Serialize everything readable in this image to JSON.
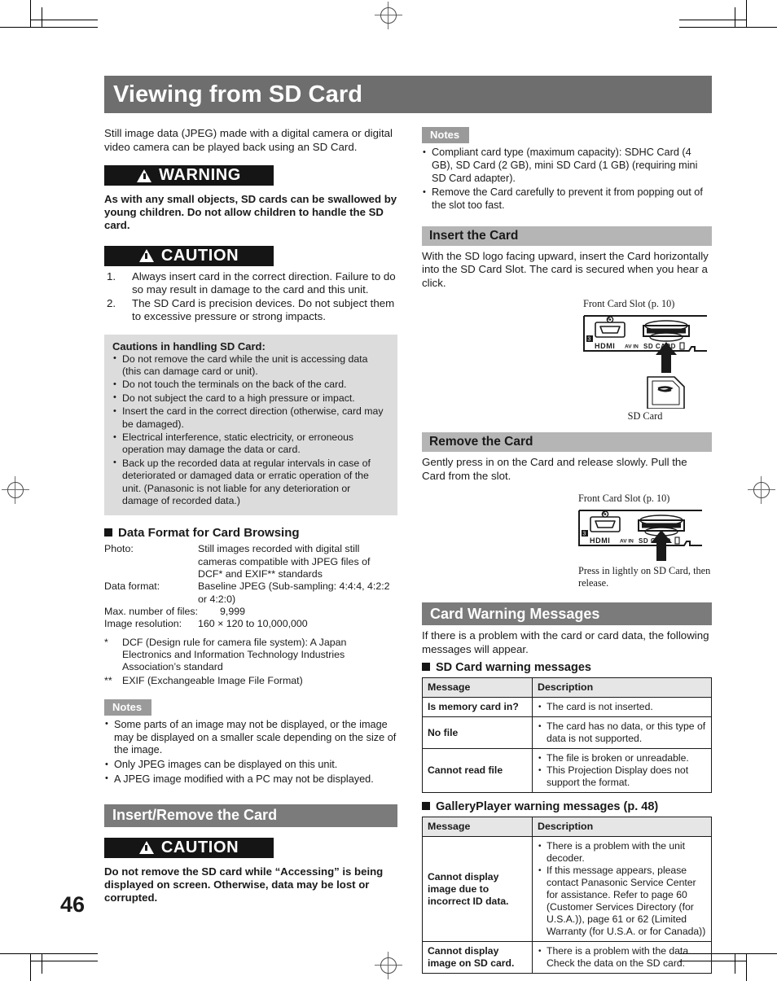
{
  "page": {
    "number": "46",
    "title": "Viewing from SD Card"
  },
  "left": {
    "intro": "Still image data (JPEG) made with a digital camera or digital video camera can be played back using an SD Card.",
    "warning": {
      "label": "WARNING",
      "text": "As with any small objects, SD cards can be swallowed by young children. Do not allow children to handle the SD card."
    },
    "caution": {
      "label": "CAUTION",
      "items": [
        {
          "num": "1.",
          "text": "Always insert card in the correct direction. Failure to do so may result in damage to the card and this unit."
        },
        {
          "num": "2.",
          "text": "The SD Card is precision devices. Do not subject them to excessive pressure or strong impacts."
        }
      ]
    },
    "handling_box": {
      "heading": "Cautions in handling SD Card:",
      "items": [
        "Do not remove the card while the unit is accessing data (this can damage card or unit).",
        "Do not touch the terminals on the back of the card.",
        "Do not subject the card to a high pressure or impact.",
        "Insert the card in the correct direction (otherwise, card may be damaged).",
        "Electrical interference, static electricity, or erroneous operation may damage the data or card.",
        "Back up the recorded data at regular intervals in case of deteriorated or damaged data or erratic operation of the unit. (Panasonic is not liable for any deterioration or damage of recorded data.)"
      ]
    },
    "data_format": {
      "heading": "Data Format for Card Browsing",
      "rows": [
        {
          "key": "Photo:",
          "value": "Still images recorded with digital still cameras compatible with JPEG files of DCF* and EXIF** standards"
        },
        {
          "key": "Data format:",
          "value": "Baseline JPEG (Sub-sampling: 4:4:4, 4:2:2 or 4:2:0)"
        },
        {
          "key": "Max. number of files:",
          "value": "9,999"
        },
        {
          "key": "Image resolution:",
          "value": "160 × 120 to 10,000,000"
        }
      ],
      "footnotes": [
        {
          "mark": "*",
          "text": "DCF (Design rule for camera file system): A Japan Electronics and Information Technology Industries Association’s standard"
        },
        {
          "mark": "**",
          "text": "EXIF (Exchangeable Image File Format)"
        }
      ]
    },
    "notes": {
      "label": "Notes",
      "items": [
        "Some parts of an image may not be displayed, or the image may be displayed on a smaller scale depending on the size of the image.",
        "Only JPEG images can be displayed on this unit.",
        "A JPEG image modified with a PC may not be displayed."
      ]
    },
    "insert_remove_section": {
      "title": "Insert/Remove the Card",
      "caution": {
        "label": "CAUTION",
        "text": "Do not remove the SD card while “Accessing” is being displayed on screen. Otherwise, data may be lost or corrupted."
      }
    }
  },
  "right": {
    "notes": {
      "label": "Notes",
      "items": [
        "Compliant card type (maximum capacity): SDHC Card (4 GB), SD Card (2 GB), mini SD Card (1 GB) (requiring mini SD Card adapter).",
        "Remove the Card carefully to prevent it from popping out of the slot too fast."
      ]
    },
    "insert_card": {
      "title": "Insert the Card",
      "text": "With the SD logo facing upward, insert the Card horizontally into the SD Card Slot. The card is secured when you hear a click.",
      "figure": {
        "caption_top": "Front Card Slot (p. 10)",
        "panel_labels": [
          "HDMI",
          "AV IN",
          "SD CARD"
        ],
        "card_label": "SD Card",
        "card_logo": "SD"
      }
    },
    "remove_card": {
      "title": "Remove the Card",
      "text": "Gently press in on the Card and release slowly. Pull the Card from the slot.",
      "figure": {
        "caption_top": "Front Card Slot (p. 10)",
        "panel_labels": [
          "HDMI",
          "AV IN",
          "SD CARD"
        ],
        "caption_bottom": "Press in lightly on SD Card, then release."
      }
    },
    "card_warning_messages": {
      "title": "Card Warning Messages",
      "intro": "If there is a problem with the card or card data, the following messages will appear.",
      "sd_table": {
        "heading": "SD Card warning messages",
        "columns": [
          "Message",
          "Description"
        ],
        "rows": [
          {
            "message": "Is memory card in?",
            "descriptions": [
              "The card is not inserted."
            ]
          },
          {
            "message": "No file",
            "descriptions": [
              "The card has no data, or this type of data is not supported."
            ]
          },
          {
            "message": "Cannot read file",
            "descriptions": [
              "The file is broken or unreadable.",
              "This Projection Display does not support the format."
            ]
          }
        ]
      },
      "gallery_table": {
        "heading": "GalleryPlayer warning messages (p. 48)",
        "columns": [
          "Message",
          "Description"
        ],
        "rows": [
          {
            "message": "Cannot display image due to incorrect ID data.",
            "descriptions": [
              "There is a problem with the unit decoder.",
              "If this message appears, please contact Panasonic Service Center for assistance. Refer to page 60 (Customer Services Directory (for U.S.A.)), page 61 or 62 (Limited Warranty (for U.S.A. or for Canada))"
            ]
          },
          {
            "message": "Cannot display image on SD card.",
            "descriptions": [
              "There is a problem with the data. Check the data on the SD card."
            ]
          }
        ]
      }
    }
  },
  "colors": {
    "title_bar": "#6e6e6e",
    "section_bar": "#7b7b7b",
    "sub_bar": "#b5b5b5",
    "notes_tab": "#9a9a9a",
    "gray_box": "#dcdcdc",
    "warn_bar": "#151515",
    "table_header": "#e6e6e6"
  }
}
